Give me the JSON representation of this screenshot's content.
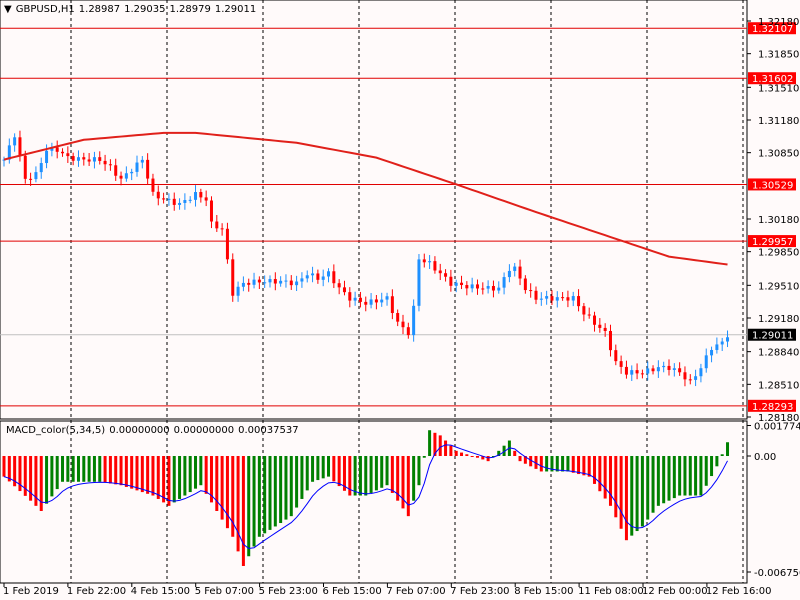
{
  "header": {
    "symbol": "GBPUSD,H1",
    "open": "1.28987",
    "high": "1.29035",
    "low": "1.28979",
    "close": "1.29011"
  },
  "macd_header": {
    "name": "MACD_color(5,34,5)",
    "v1": "0.00000000",
    "v2": "0.00000000",
    "v3": "0.00037537"
  },
  "colors": {
    "bull": "#1e90ff",
    "bear": "#ff0000",
    "hist_up": "#008000",
    "hist_down": "#ff0000",
    "ma": "#e0201a",
    "signal": "#0000ff"
  },
  "chart_data": [
    {
      "type": "candlestick",
      "title": "GBPUSD,H1",
      "ylim": [
        1.2813,
        1.3225
      ],
      "y_ticks": [
        "1.32180",
        "1.31850",
        "1.31510",
        "1.31180",
        "1.30850",
        "1.30180",
        "1.29850",
        "1.29510",
        "1.29180",
        "1.28840",
        "1.28510",
        "1.28180"
      ],
      "x_ticks": [
        "1 Feb 2019",
        "1 Feb 22:00",
        "4 Feb 15:00",
        "5 Feb 07:00",
        "5 Feb 23:00",
        "6 Feb 15:00",
        "7 Feb 07:00",
        "7 Feb 23:00",
        "8 Feb 15:00",
        "11 Feb 08:00",
        "12 Feb 00:00",
        "12 Feb 16:00"
      ],
      "close_path": [
        [
          0,
          1.3078
        ],
        [
          2,
          1.3103
        ],
        [
          4,
          1.3058
        ],
        [
          6,
          1.3063
        ],
        [
          8,
          1.3088
        ],
        [
          10,
          1.3088
        ],
        [
          12,
          1.308
        ],
        [
          15,
          1.3078
        ],
        [
          18,
          1.3078
        ],
        [
          20,
          1.307
        ],
        [
          22,
          1.3058
        ],
        [
          24,
          1.3068
        ],
        [
          26,
          1.3078
        ],
        [
          28,
          1.3043
        ],
        [
          30,
          1.3038
        ],
        [
          33,
          1.3033
        ],
        [
          36,
          1.3043
        ],
        [
          38,
          1.3038
        ],
        [
          39,
          1.3013
        ],
        [
          41,
          1.3008
        ],
        [
          43,
          1.2943
        ],
        [
          45,
          1.2953
        ],
        [
          48,
          1.2955
        ],
        [
          52,
          1.2955
        ],
        [
          55,
          1.2953
        ],
        [
          57,
          1.2963
        ],
        [
          59,
          1.2958
        ],
        [
          61,
          1.2963
        ],
        [
          63,
          1.2948
        ],
        [
          65,
          1.2938
        ],
        [
          68,
          1.2933
        ],
        [
          72,
          1.2938
        ],
        [
          74,
          1.2913
        ],
        [
          76,
          1.2903
        ],
        [
          77,
          1.2928
        ],
        [
          78,
          1.2978
        ],
        [
          80,
          1.2973
        ],
        [
          82,
          1.2963
        ],
        [
          84,
          1.2953
        ],
        [
          87,
          1.295
        ],
        [
          91,
          1.2948
        ],
        [
          93,
          1.2948
        ],
        [
          95,
          1.2968
        ],
        [
          96,
          1.2968
        ],
        [
          98,
          1.2948
        ],
        [
          100,
          1.2938
        ],
        [
          103,
          1.2938
        ],
        [
          107,
          1.2938
        ],
        [
          109,
          1.2923
        ],
        [
          111,
          1.2913
        ],
        [
          113,
          1.2903
        ],
        [
          115,
          1.2873
        ],
        [
          117,
          1.2863
        ],
        [
          120,
          1.2863
        ],
        [
          123,
          1.2868
        ],
        [
          125,
          1.2868
        ],
        [
          127,
          1.2863
        ],
        [
          129,
          1.2853
        ],
        [
          131,
          1.2868
        ],
        [
          133,
          1.2888
        ],
        [
          135,
          1.2893
        ],
        [
          136,
          1.2901
        ]
      ],
      "ma_path": [
        [
          0,
          1.3078
        ],
        [
          15,
          1.3098
        ],
        [
          30,
          1.3105
        ],
        [
          36,
          1.3105
        ],
        [
          55,
          1.3095
        ],
        [
          70,
          1.308
        ],
        [
          85,
          1.3053
        ],
        [
          100,
          1.3025
        ],
        [
          115,
          1.2998
        ],
        [
          125,
          1.298
        ],
        [
          136,
          1.2972
        ]
      ],
      "price_levels": [
        1.32107,
        1.31602,
        1.30529,
        1.29957,
        1.28293
      ],
      "current_price": "1.29011",
      "level_labels": [
        "1.32107",
        "1.31602",
        "1.30529",
        "1.29957",
        "1.28293"
      ]
    },
    {
      "type": "bar",
      "title": "MACD_color(5,34,5)",
      "ylim": [
        -0.00675,
        0.0017746
      ],
      "y_ticks": [
        "0.0017746",
        "0.00",
        "-0.006750"
      ],
      "hist_path": [
        [
          0,
          -0.0012
        ],
        [
          5,
          -0.0026
        ],
        [
          7,
          -0.0032
        ],
        [
          11,
          -0.0015
        ],
        [
          18,
          -0.0015
        ],
        [
          22,
          -0.0017
        ],
        [
          28,
          -0.0023
        ],
        [
          31,
          -0.0029
        ],
        [
          37,
          -0.0017
        ],
        [
          43,
          -0.0047
        ],
        [
          45,
          -0.0064
        ],
        [
          48,
          -0.0047
        ],
        [
          54,
          -0.0035
        ],
        [
          58,
          -0.0015
        ],
        [
          61,
          -0.0012
        ],
        [
          65,
          -0.0023
        ],
        [
          68,
          -0.0023
        ],
        [
          72,
          -0.0017
        ],
        [
          76,
          -0.0035
        ],
        [
          78,
          -0.0017
        ],
        [
          80,
          0.0015
        ],
        [
          82,
          0.0012
        ],
        [
          85,
          0.0003
        ],
        [
          91,
          -0.0003
        ],
        [
          93,
          0.0003
        ],
        [
          95,
          0.0009
        ],
        [
          97,
          -0.0003
        ],
        [
          101,
          -0.0009
        ],
        [
          106,
          -0.0009
        ],
        [
          110,
          -0.0012
        ],
        [
          114,
          -0.0029
        ],
        [
          117,
          -0.0049
        ],
        [
          120,
          -0.0041
        ],
        [
          123,
          -0.0029
        ],
        [
          127,
          -0.0023
        ],
        [
          131,
          -0.0023
        ],
        [
          134,
          -0.0006
        ],
        [
          136,
          0.0008
        ]
      ]
    }
  ]
}
